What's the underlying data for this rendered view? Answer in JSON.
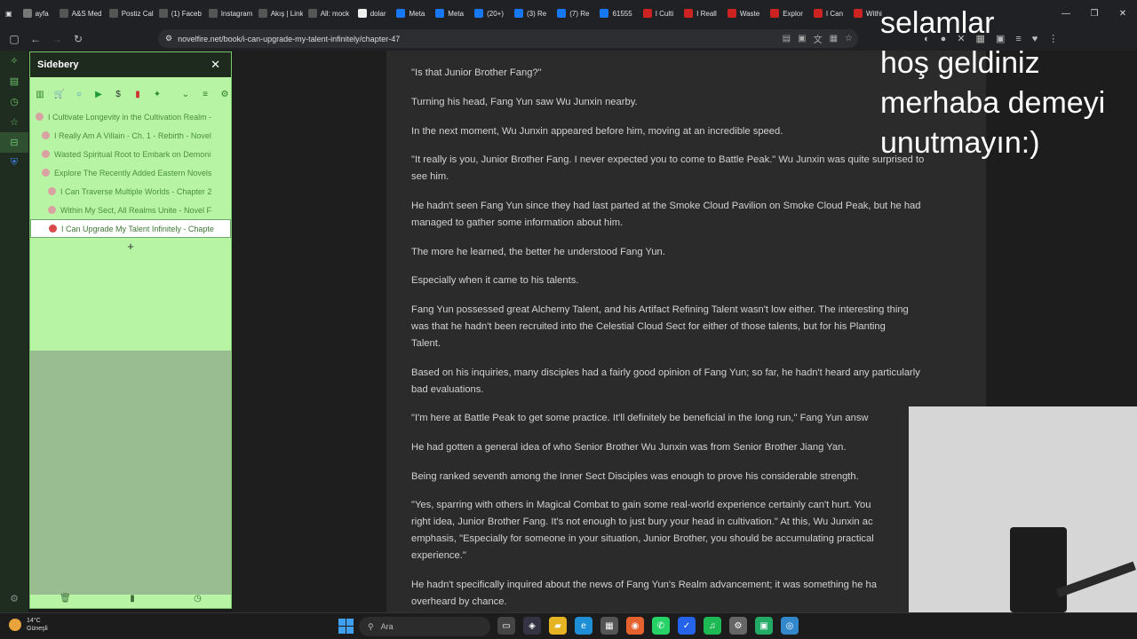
{
  "browser": {
    "tabs": [
      {
        "label": "ayfa",
        "color": "#777"
      },
      {
        "label": "A&S Med",
        "color": "#555"
      },
      {
        "label": "Postiz Cal",
        "color": "#555"
      },
      {
        "label": "(1) Faceb",
        "color": "#555"
      },
      {
        "label": "Instagram",
        "color": "#555"
      },
      {
        "label": "Akış | Link",
        "color": "#555"
      },
      {
        "label": "All: mock",
        "color": "#555"
      },
      {
        "label": "dolar",
        "color": "#eee"
      },
      {
        "label": "Meta",
        "color": "#1877f2"
      },
      {
        "label": "Meta",
        "color": "#1877f2"
      },
      {
        "label": "(20+)",
        "color": "#1877f2"
      },
      {
        "label": "(3) Re",
        "color": "#1877f2"
      },
      {
        "label": "(7) Re",
        "color": "#1877f2"
      },
      {
        "label": "61555",
        "color": "#1877f2"
      },
      {
        "label": "I Culti",
        "color": "#c22"
      },
      {
        "label": "I Reall",
        "color": "#c22"
      },
      {
        "label": "Waste",
        "color": "#c22"
      },
      {
        "label": "Explor",
        "color": "#c22"
      },
      {
        "label": "I Can",
        "color": "#c22"
      },
      {
        "label": "Withi",
        "color": "#c22"
      }
    ],
    "url": "novelfire.net/book/i-can-upgrade-my-talent-infinitely/chapter-47"
  },
  "sidebar": {
    "title": "Sidebery",
    "items": [
      {
        "label": "I Cultivate Longevity in the Cultivation Realm -",
        "indent": 0
      },
      {
        "label": "I Really Am A Villain - Ch. 1 - Rebirth - Novel",
        "indent": 1
      },
      {
        "label": "Wasted Spiritual Root to Embark on Demoni",
        "indent": 1
      },
      {
        "label": "Explore The Recently Added Eastern Novels",
        "indent": 1
      },
      {
        "label": "I Can Traverse Multiple Worlds - Chapter 2",
        "indent": 2
      },
      {
        "label": "Within My Sect, All Realms Unite - Novel F",
        "indent": 2
      },
      {
        "label": "I Can Upgrade My Talent Infinitely - Chapte",
        "indent": 2
      }
    ],
    "add": "+"
  },
  "article": {
    "paragraphs": [
      "\"Is that Junior Brother Fang?\"",
      "Turning his head, Fang Yun saw Wu Junxin nearby.",
      "In the next moment, Wu Junxin appeared before him, moving at an incredible speed.",
      "\"It really is you, Junior Brother Fang. I never expected you to come to Battle Peak.\" Wu Junxin was quite surprised to\nsee him.",
      "He hadn't seen Fang Yun since they had last parted at the Smoke Cloud Pavilion on Smoke Cloud Peak, but he had\nmanaged to gather some information about him.",
      "The more he learned, the better he understood Fang Yun.",
      "Especially when it came to his talents.",
      "Fang Yun possessed great Alchemy Talent, and his Artifact Refining Talent wasn't low either. The interesting thing\nwas that he hadn't been recruited into the Celestial Cloud Sect for either of those talents, but for his Planting\nTalent.",
      "Based on his inquiries, many disciples had a fairly good opinion of Fang Yun; so far, he hadn't heard any particularly\nbad evaluations.",
      "\"I'm here at Battle Peak to get some practice. It'll definitely be beneficial in the long run,\" Fang Yun answ",
      "He had gotten a general idea of who Senior Brother Wu Junxin was from Senior Brother Jiang Yan.",
      "Being ranked seventh among the Inner Sect Disciples was enough to prove his considerable strength.",
      "\"Yes, sparring with others in Magical Combat to gain some real-world experience certainly can't hurt. You\nright idea, Junior Brother Fang. It's not enough to just bury your head in cultivation.\" At this, Wu Junxin ac\nemphasis, \"Especially for someone in your situation, Junior Brother, you should be accumulating practical\nexperience.\"",
      "He hadn't specifically inquired about the news of Fang Yun's Realm advancement; it was something he ha\noverheard by chance."
    ]
  },
  "overlay": {
    "lines": [
      "selamlar",
      "hoş geldiniz",
      "merhaba demeyi",
      "unutmayın:)"
    ]
  },
  "taskbar": {
    "temp": "14°C",
    "weather": "Güneşli",
    "search_placeholder": "Ara"
  }
}
